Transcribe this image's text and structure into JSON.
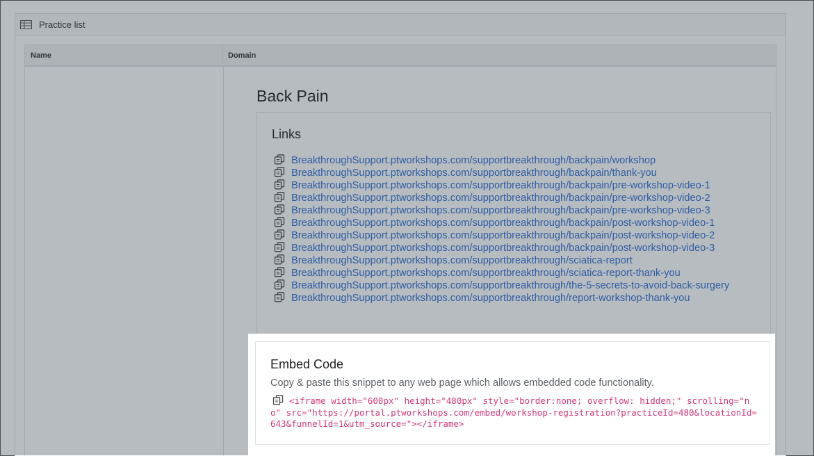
{
  "panel": {
    "title": "Practice list",
    "icon": "table-icon"
  },
  "table": {
    "headers": [
      "Name",
      "Domain"
    ]
  },
  "section": {
    "title": "Back Pain"
  },
  "links": {
    "title": "Links",
    "copy_icon": "copy-icon",
    "link_color": "#2f6fd0",
    "items": [
      "BreakthroughSupport.ptworkshops.com/supportbreakthrough/backpain/workshop",
      "BreakthroughSupport.ptworkshops.com/supportbreakthrough/backpain/thank-you",
      "BreakthroughSupport.ptworkshops.com/supportbreakthrough/backpain/pre-workshop-video-1",
      "BreakthroughSupport.ptworkshops.com/supportbreakthrough/backpain/pre-workshop-video-2",
      "BreakthroughSupport.ptworkshops.com/supportbreakthrough/backpain/pre-workshop-video-3",
      "BreakthroughSupport.ptworkshops.com/supportbreakthrough/backpain/post-workshop-video-1",
      "BreakthroughSupport.ptworkshops.com/supportbreakthrough/backpain/post-workshop-video-2",
      "BreakthroughSupport.ptworkshops.com/supportbreakthrough/backpain/post-workshop-video-3",
      "BreakthroughSupport.ptworkshops.com/supportbreakthrough/sciatica-report",
      "BreakthroughSupport.ptworkshops.com/supportbreakthrough/sciatica-report-thank-you",
      "BreakthroughSupport.ptworkshops.com/supportbreakthrough/the-5-secrets-to-avoid-back-surgery",
      "BreakthroughSupport.ptworkshops.com/supportbreakthrough/report-workshop-thank-you"
    ]
  },
  "embed": {
    "title": "Embed Code",
    "description": "Copy & paste this snippet to any web page which allows embedded code functionality.",
    "code": "<iframe width=\"600px\" height=\"480px\" style=\"border:none; overflow: hidden;\" scrolling=\"no\" src=\"https://portal.ptworkshops.com/embed/workshop-registration?practiceId=480&locationId=643&funnelId=1&utm_source=\"></iframe>",
    "code_color": "#d4377a"
  }
}
